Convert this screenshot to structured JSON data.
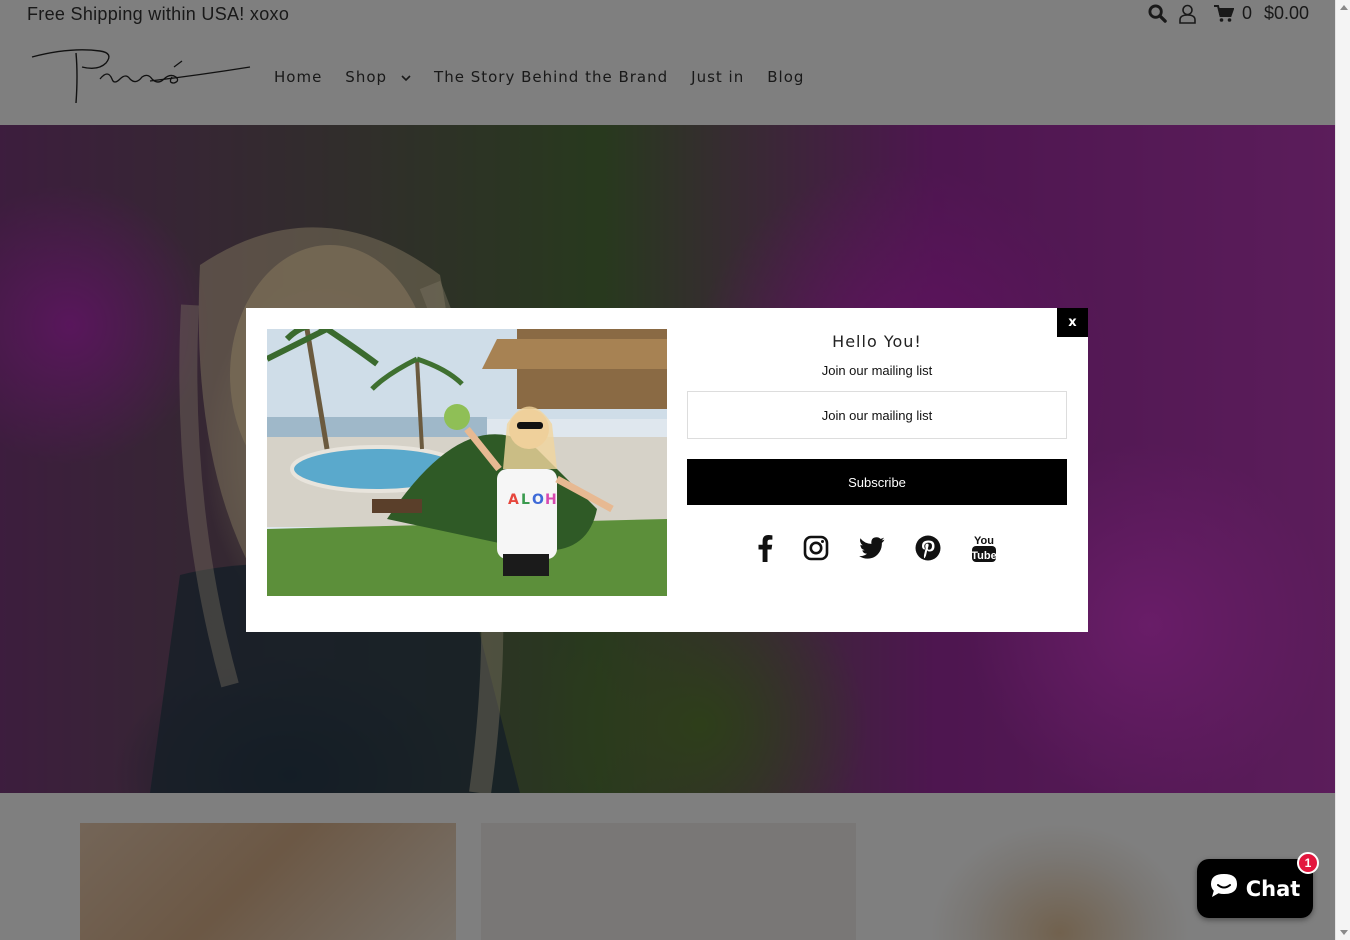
{
  "announcement": {
    "text": "Free Shipping within USA! xoxo"
  },
  "header_tools": {
    "search_icon": "search-icon",
    "account_icon": "user-icon",
    "cart_icon": "cart-icon",
    "cart_count": "0",
    "cart_total": "$0.00"
  },
  "nav": {
    "items": [
      {
        "label": "Home"
      },
      {
        "label": "Shop"
      },
      {
        "label": "The Story Behind the Brand"
      },
      {
        "label": "Just in"
      },
      {
        "label": "Blog"
      }
    ]
  },
  "popup": {
    "close_label": "x",
    "title": "Hello You!",
    "subtitle": "Join our mailing list",
    "email_placeholder": "Join our mailing list",
    "email_value": "",
    "button_label": "Subscribe",
    "social_icons": [
      "facebook-icon",
      "instagram-icon",
      "twitter-icon",
      "pinterest-icon",
      "youtube-icon"
    ]
  },
  "chat": {
    "label": "Chat",
    "badge_count": "1",
    "accent": "#e3173e"
  },
  "colors": {
    "overlay": "#000000",
    "button": "#000000",
    "text": "#333333"
  }
}
